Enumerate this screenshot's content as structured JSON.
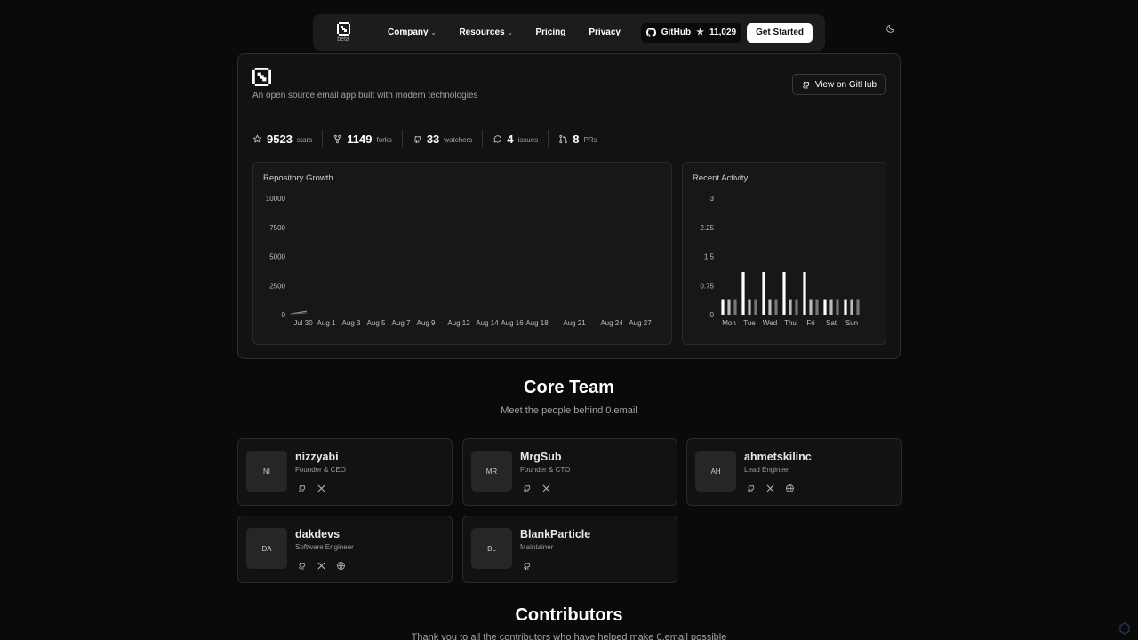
{
  "nav": {
    "beta": "beta",
    "items": [
      {
        "label": "Company",
        "dropdown": true
      },
      {
        "label": "Resources",
        "dropdown": true
      },
      {
        "label": "Pricing",
        "dropdown": false
      },
      {
        "label": "Privacy",
        "dropdown": false
      }
    ],
    "github_label": "GitHub",
    "github_stars": "11,029",
    "cta": "Get Started"
  },
  "repo": {
    "description": "An open source email app built with modern technologies",
    "view_button": "View on GitHub",
    "stats": [
      {
        "icon": "star-icon",
        "value": "9523",
        "label": "stars"
      },
      {
        "icon": "fork-icon",
        "value": "1149",
        "label": "forks"
      },
      {
        "icon": "github-icon",
        "value": "33",
        "label": "watchers"
      },
      {
        "icon": "message-icon",
        "value": "4",
        "label": "issues"
      },
      {
        "icon": "pull-request-icon",
        "value": "8",
        "label": "PRs"
      }
    ]
  },
  "chart_data": [
    {
      "type": "line",
      "title": "Repository Growth",
      "x": [
        "Jul 30",
        "Aug 1",
        "Aug 3",
        "Aug 5",
        "Aug 7",
        "Aug 9",
        "Aug 12",
        "Aug 14",
        "Aug 16",
        "Aug 18",
        "Aug 21",
        "Aug 24",
        "Aug 27"
      ],
      "ylim": [
        0,
        10000
      ],
      "yticks": [
        "10000",
        "7500",
        "5000",
        "2500",
        "0"
      ],
      "series": [
        {
          "values": [
            300,
            0,
            0,
            0,
            0,
            0,
            0,
            0,
            0,
            0,
            0,
            0,
            0
          ]
        },
        {
          "values": [
            150,
            0,
            0,
            0,
            0,
            0,
            0,
            0,
            0,
            0,
            0,
            0,
            0
          ]
        }
      ]
    },
    {
      "type": "bar",
      "title": "Recent Activity",
      "categories": [
        "Mon",
        "Tue",
        "Wed",
        "Thu",
        "Fri",
        "Sat",
        "Sun"
      ],
      "ylim": [
        0,
        3
      ],
      "yticks": [
        "3",
        "2.25",
        "1.5",
        "0.75",
        "0"
      ],
      "series": [
        {
          "values": [
            0.4,
            1.1,
            1.1,
            1.1,
            1.1,
            0.4,
            0.4
          ],
          "color": "#ffffff"
        },
        {
          "values": [
            0.4,
            0.4,
            0.4,
            0.4,
            0.4,
            0.4,
            0.4
          ],
          "color": "#bbbbbb"
        },
        {
          "values": [
            0.4,
            0.4,
            0.4,
            0.4,
            0.4,
            0.4,
            0.4
          ],
          "color": "#777777"
        }
      ]
    }
  ],
  "team": {
    "title": "Core Team",
    "subtitle": "Meet the people behind 0.email",
    "members": [
      {
        "initials": "NI",
        "name": "nizzyabi",
        "role": "Founder & CEO",
        "links": [
          "github",
          "x"
        ]
      },
      {
        "initials": "MR",
        "name": "MrgSub",
        "role": "Founder & CTO",
        "links": [
          "github",
          "x"
        ]
      },
      {
        "initials": "AH",
        "name": "ahmetskilinc",
        "role": "Lead Engineer",
        "links": [
          "github",
          "x",
          "web"
        ]
      },
      {
        "initials": "DA",
        "name": "dakdevs",
        "role": "Software Engineer",
        "links": [
          "github",
          "x",
          "web"
        ]
      },
      {
        "initials": "BL",
        "name": "BlankParticle",
        "role": "Maintainer",
        "links": [
          "github"
        ]
      }
    ]
  },
  "contributors": {
    "title": "Contributors",
    "subtitle": "Thank you to all the contributors who have helped make 0.email possible"
  }
}
